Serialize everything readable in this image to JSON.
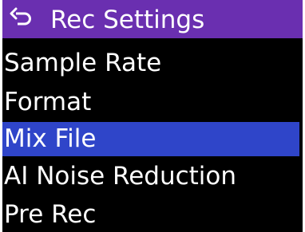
{
  "header": {
    "title": "Rec Settings",
    "back_icon": "back-arrow-icon"
  },
  "colors": {
    "header_bg": "#6a2fb0",
    "selected_bg": "#2f45c9",
    "screen_bg": "#000000",
    "text": "#ffffff"
  },
  "menu": {
    "items": [
      {
        "label": "Sample Rate",
        "selected": false
      },
      {
        "label": "Format",
        "selected": false
      },
      {
        "label": "Mix File",
        "selected": true
      },
      {
        "label": "AI Noise Reduction",
        "selected": false
      },
      {
        "label": "Pre Rec",
        "selected": false
      }
    ]
  }
}
